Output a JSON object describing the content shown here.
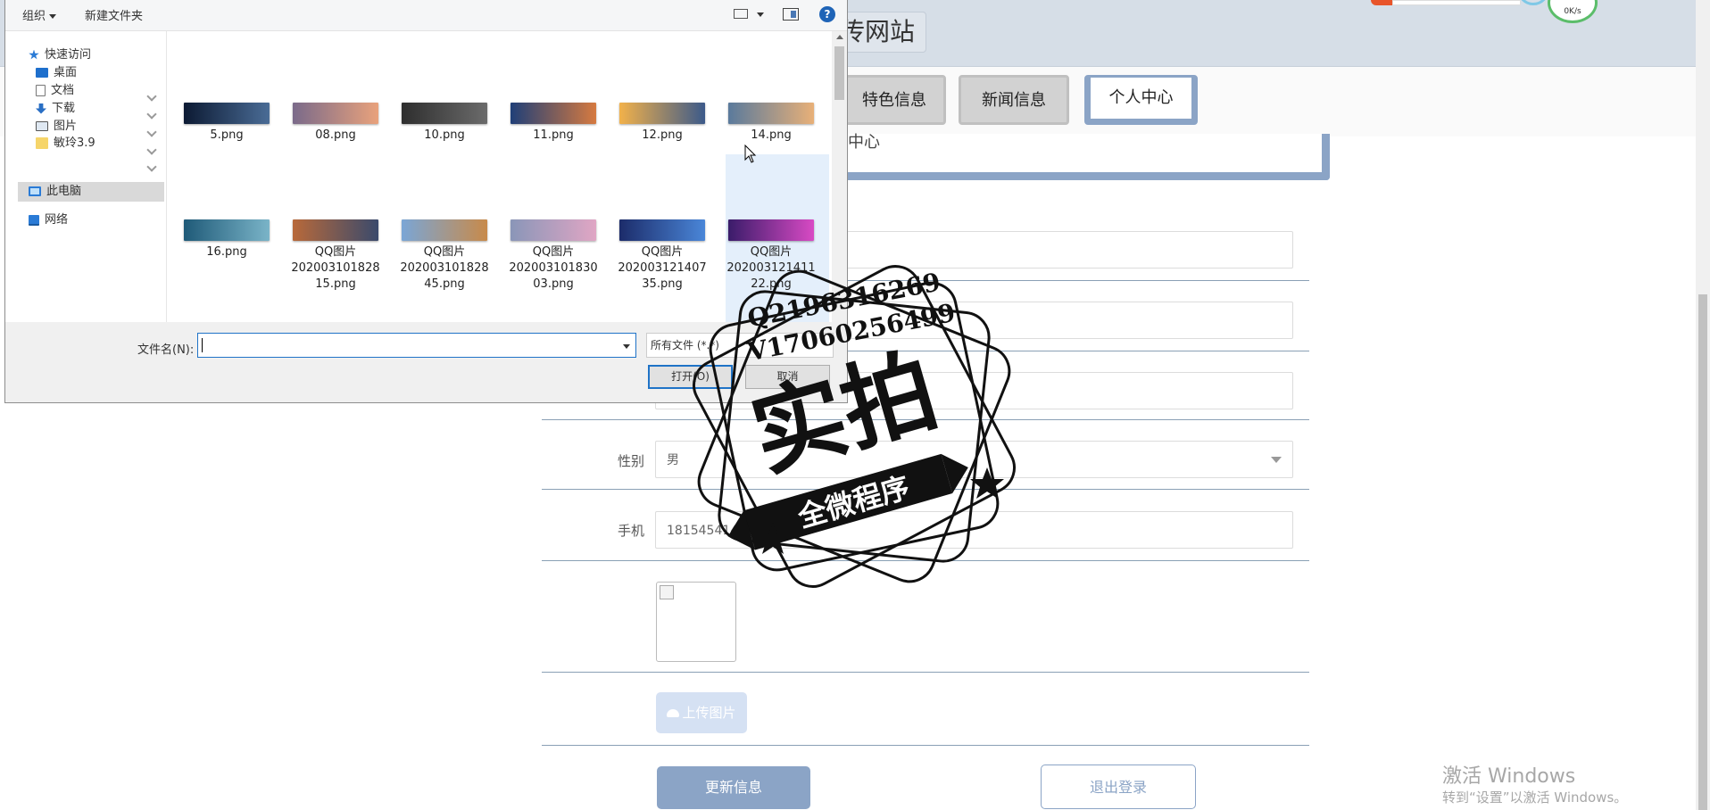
{
  "site": {
    "title": "传网站",
    "nav_tabs": [
      {
        "label": "特色信息"
      },
      {
        "label": "新闻信息"
      },
      {
        "label": "个人中心"
      }
    ],
    "section_title": "中心",
    "net_speed": "0K/s"
  },
  "form": {
    "gender_label": "性别",
    "gender_value": "男",
    "phone_label": "手机",
    "phone_value": "18154541454",
    "upload_label": "上传图片",
    "update_label": "更新信息",
    "logout_label": "退出登录"
  },
  "dialog": {
    "organize_label": "组织",
    "new_folder_label": "新建文件夹",
    "help_label": "?",
    "nav": [
      {
        "label": "快速访问"
      },
      {
        "label": "桌面"
      },
      {
        "label": "文档"
      },
      {
        "label": "下载"
      },
      {
        "label": "图片"
      },
      {
        "label": "敏玲3.9"
      },
      {
        "label": "此电脑"
      },
      {
        "label": "网络"
      }
    ],
    "files": [
      {
        "name": "5.png",
        "colors": [
          "#0c1a33",
          "#4a6c96"
        ]
      },
      {
        "name": "08.png",
        "colors": [
          "#7a6a8a",
          "#e9a27c"
        ]
      },
      {
        "name": "10.png",
        "colors": [
          "#2e2e2e",
          "#6b6b6b"
        ]
      },
      {
        "name": "11.png",
        "colors": [
          "#1f3f78",
          "#d67a40"
        ]
      },
      {
        "name": "12.png",
        "colors": [
          "#f2b14a",
          "#3c5a8a"
        ]
      },
      {
        "name": "14.png",
        "colors": [
          "#5a7a9c",
          "#e8b078"
        ]
      },
      {
        "name": "16.png",
        "colors": [
          "#1f5a78",
          "#7ab4c8"
        ]
      },
      {
        "name": "QQ图片20200310182815.png",
        "line1": "QQ图片",
        "line2": "202003101828",
        "line3": "15.png",
        "colors": [
          "#b8693a",
          "#3a4a6c"
        ]
      },
      {
        "name": "QQ图片20200310182845.png",
        "line1": "QQ图片",
        "line2": "202003101828",
        "line3": "45.png",
        "colors": [
          "#7aa6d6",
          "#c88a4a"
        ]
      },
      {
        "name": "QQ图片20200310183003.png",
        "line1": "QQ图片",
        "line2": "202003101830",
        "line3": "03.png",
        "colors": [
          "#8a96b8",
          "#e0a6c4"
        ]
      },
      {
        "name": "QQ图片20200312140735.png",
        "line1": "QQ图片",
        "line2": "202003121407",
        "line3": "35.png",
        "colors": [
          "#1c2c6a",
          "#4a86d8"
        ]
      },
      {
        "name": "QQ图片20200312141122.png",
        "line1": "QQ图片",
        "line2": "202003121411",
        "line3": "22.png",
        "colors": [
          "#3a1c6a",
          "#d84ac4"
        ]
      }
    ],
    "filename_label": "文件名(N):",
    "filename_value": "",
    "filetype_value": "所有文件 (*.*)",
    "open_label": "打开(O)",
    "cancel_label": "取消"
  },
  "watermark": {
    "line1": "Q2196316269",
    "line2": "V17060256499",
    "main": "实拍",
    "banner": "全微程序"
  },
  "windows_activation": {
    "title": "激活 Windows",
    "subtitle": "转到“设置”以激活 Windows。"
  }
}
